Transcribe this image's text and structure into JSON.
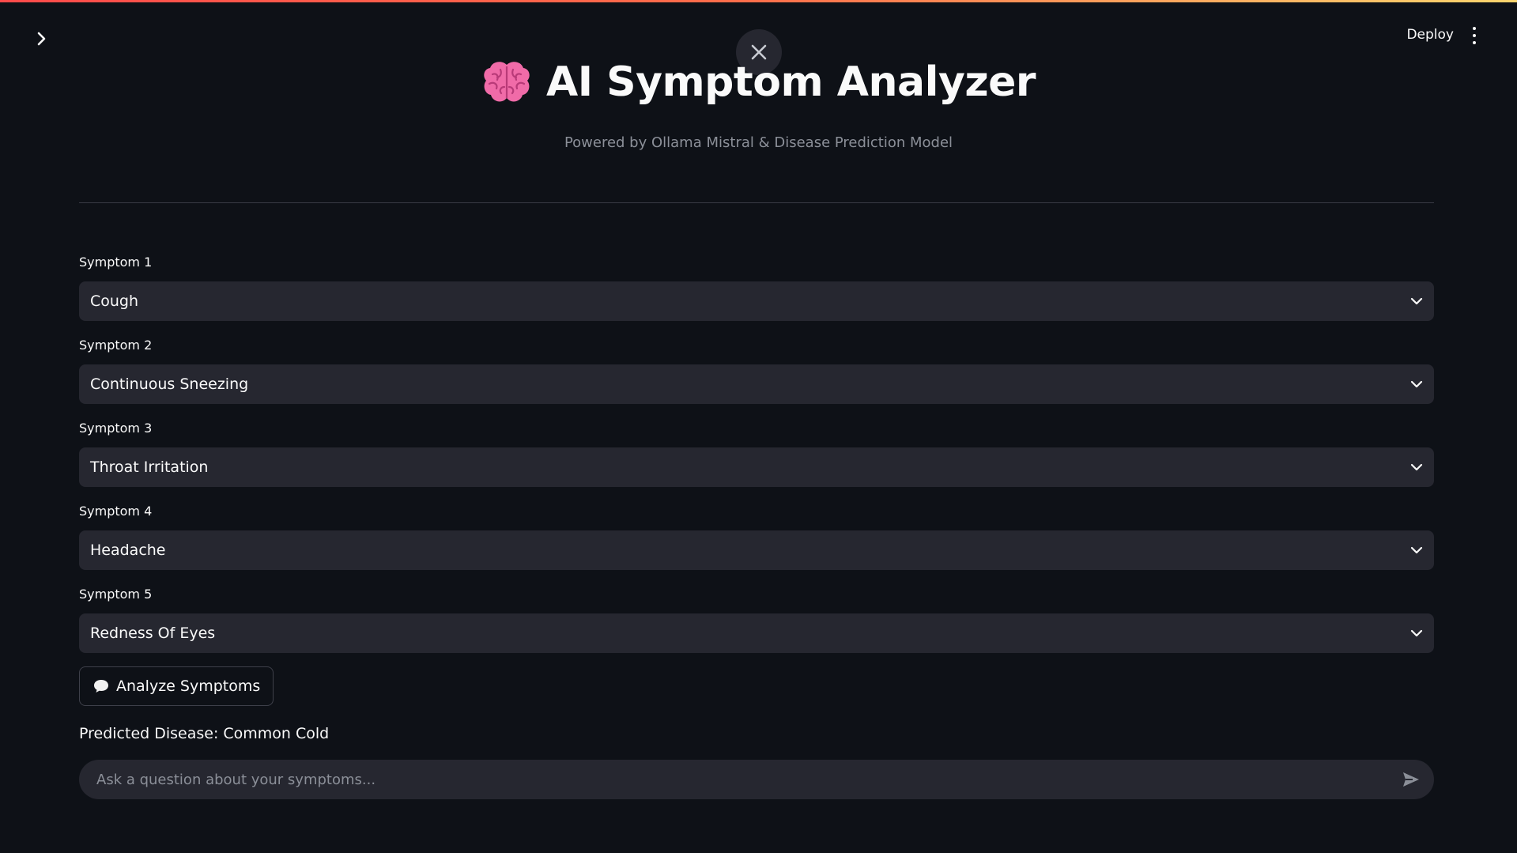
{
  "header": {
    "deploy_label": "Deploy",
    "menu_icon": "kebab-menu-icon",
    "sidebar_toggle_icon": "chevron-right-icon",
    "close_icon": "close-icon",
    "accent_gradient": [
      "#ff4b4b",
      "#ff6f4b",
      "#fdd66e"
    ]
  },
  "page": {
    "title": "AI Symptom Analyzer",
    "title_icon": "brain-icon",
    "subtitle": "Powered by Ollama Mistral & Disease Prediction Model"
  },
  "symptoms": [
    {
      "label": "Symptom 1",
      "value": "Cough"
    },
    {
      "label": "Symptom 2",
      "value": "Continuous Sneezing"
    },
    {
      "label": "Symptom 3",
      "value": "Throat Irritation"
    },
    {
      "label": "Symptom 4",
      "value": "Headache"
    },
    {
      "label": "Symptom 5",
      "value": "Redness Of Eyes"
    }
  ],
  "analyze": {
    "label": "Analyze Symptoms",
    "icon": "speech-bubble-icon"
  },
  "result": {
    "prediction_text": "Predicted Disease: Common Cold"
  },
  "chat": {
    "placeholder": "Ask a question about your symptoms...",
    "send_icon": "send-icon"
  },
  "colors": {
    "background": "#0e1117",
    "input_bg": "#262730",
    "text": "#fafafa",
    "muted": "#8b8f98",
    "brain_pink": "#f06ba8"
  }
}
